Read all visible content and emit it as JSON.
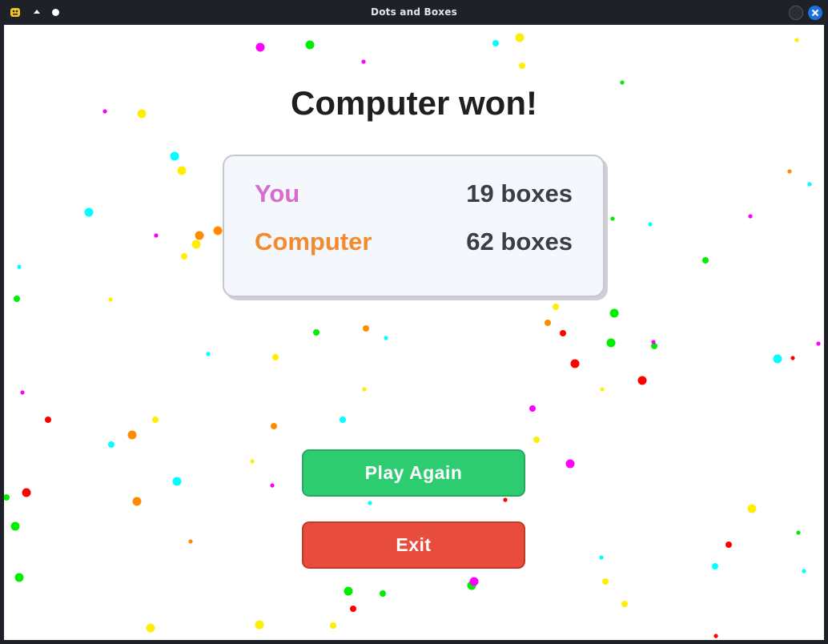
{
  "window": {
    "title": "Dots and Boxes"
  },
  "result": {
    "heading": "Computer won!"
  },
  "scores": [
    {
      "player": "You",
      "value": "19 boxes",
      "color": "#d86bd0"
    },
    {
      "player": "Computer",
      "value": "62 boxes",
      "color": "#f28a2e"
    }
  ],
  "buttons": {
    "play_again": "Play Again",
    "exit": "Exit"
  },
  "colors": {
    "play_again": "#2ecc71",
    "exit": "#e74c3c",
    "confetti": [
      "#ff0000",
      "#00ee00",
      "#00ffff",
      "#ff00ff",
      "#ffee00",
      "#ff8c00"
    ]
  }
}
